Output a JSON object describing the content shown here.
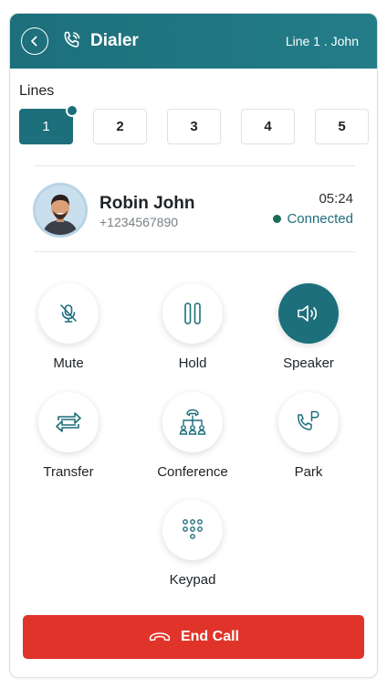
{
  "header": {
    "title": "Dialer",
    "line_info": "Line 1 . John"
  },
  "lines": {
    "label": "Lines",
    "items": [
      "1",
      "2",
      "3",
      "4",
      "5"
    ],
    "active_index": 0
  },
  "caller": {
    "name": "Robin John",
    "number": "+1234567890",
    "duration": "05:24",
    "status": "Connected"
  },
  "controls": {
    "mute": "Mute",
    "hold": "Hold",
    "speaker": "Speaker",
    "transfer": "Transfer",
    "conference": "Conference",
    "park": "Park",
    "keypad": "Keypad"
  },
  "end_call": "End Call",
  "colors": {
    "primary": "#1d6f7c",
    "danger": "#e0342a",
    "connected": "#1a6b56"
  }
}
